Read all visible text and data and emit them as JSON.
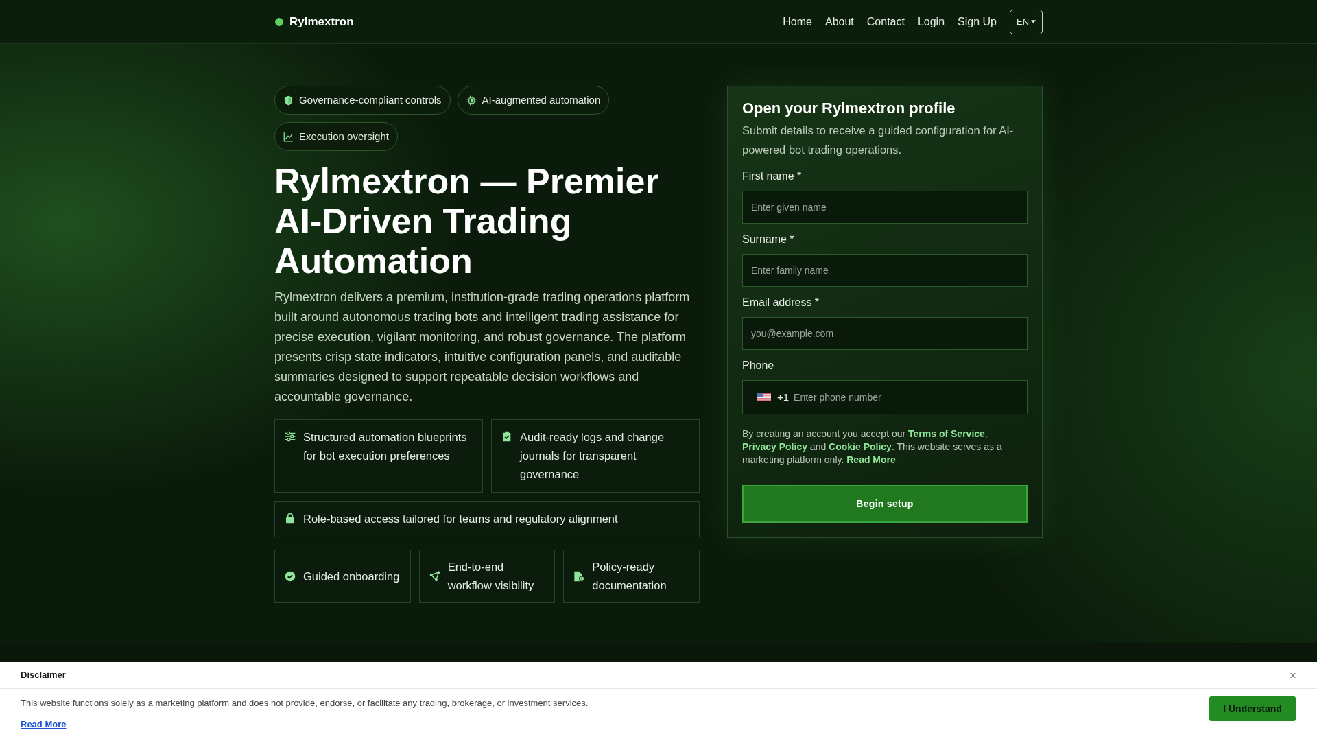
{
  "header": {
    "brand": "Rylmextron",
    "nav": [
      {
        "label": "Home"
      },
      {
        "label": "About"
      },
      {
        "label": "Contact"
      },
      {
        "label": "Login"
      },
      {
        "label": "Sign Up"
      }
    ],
    "language": "EN"
  },
  "hero": {
    "badges": [
      "Governance-compliant controls",
      "AI-augmented automation",
      "Execution oversight"
    ],
    "title": "Rylmextron — Premier AI-Driven Trading Automation",
    "description": "Rylmextron delivers a premium, institution-grade trading operations platform built around autonomous trading bots and intelligent trading assistance for precise execution, vigilant monitoring, and robust governance. The platform presents crisp state indicators, intuitive configuration panels, and auditable summaries designed to support repeatable decision workflows and accountable governance.",
    "feature_rows": [
      [
        "Structured automation blueprints for bot execution preferences",
        "Audit-ready logs and change journals for transparent governance"
      ],
      [
        "Role-based access tailored for teams and regulatory alignment"
      ],
      [
        "Guided onboarding",
        "End-to-end workflow visibility",
        "Policy-ready documentation"
      ]
    ]
  },
  "signup": {
    "title": "Open your Rylmextron profile",
    "subtitle": "Submit details to receive a guided configuration for AI-powered bot trading operations.",
    "fields": [
      {
        "kind": "text",
        "label": "First name *",
        "placeholder": "Enter given name"
      },
      {
        "kind": "text",
        "label": "Surname *",
        "placeholder": "Enter family name"
      },
      {
        "kind": "email",
        "label": "Email address *",
        "placeholder": "you@example.com"
      },
      {
        "kind": "phone",
        "label": "Phone",
        "dial_code": "+1",
        "placeholder": "Enter phone number"
      }
    ],
    "consent": [
      {
        "kind": "text",
        "text": "By creating an account you accept our "
      },
      {
        "kind": "link",
        "text": "Terms of Service"
      },
      {
        "kind": "text",
        "text": ", "
      },
      {
        "kind": "link",
        "text": "Privacy Policy"
      },
      {
        "kind": "text",
        "text": " and "
      },
      {
        "kind": "link",
        "text": "Cookie Policy"
      },
      {
        "kind": "text",
        "text": ". This website serves as a marketing platform only. "
      },
      {
        "kind": "link",
        "text": "Read More"
      }
    ],
    "submit": "Begin setup"
  },
  "disclaimer": {
    "title": "Disclaimer",
    "close": "×",
    "text": "This website functions solely as a marketing platform and does not provide, endorse, or facilitate any trading, brokerage, or investment services.",
    "link": "Read More",
    "button": "I Understand"
  }
}
